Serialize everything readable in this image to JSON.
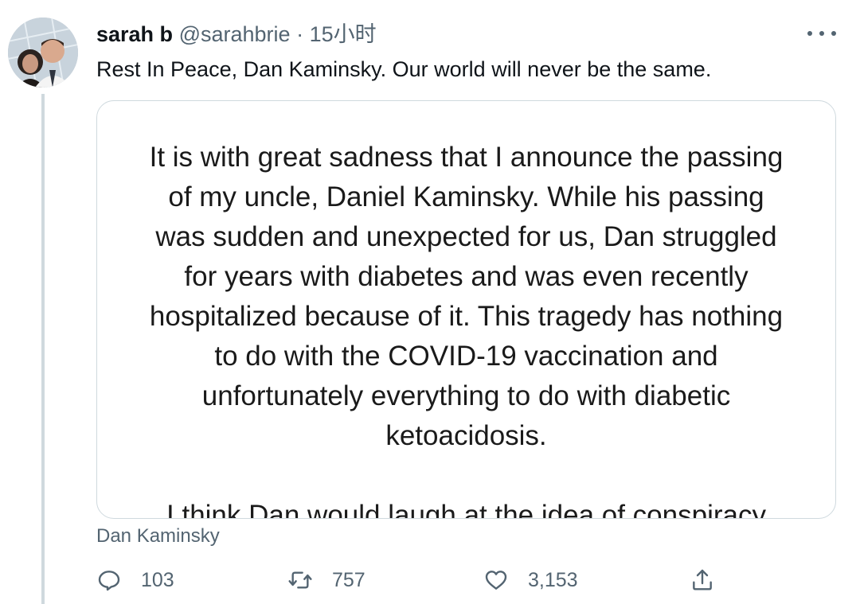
{
  "tweet": {
    "author_name": "sarah b",
    "handle": "@sarahbrie",
    "separator": "·",
    "time": "15小时",
    "text": "Rest In Peace, Dan Kaminsky. Our world will never be the same.",
    "media": {
      "paragraph_1": "It is with great sadness that I announce the passing of my uncle, Daniel Kaminsky. While his passing was sudden and unexpected for us, Dan struggled for years with diabetes and was even recently hospitalized because of it. This tragedy has nothing to do with the COVID-19 vaccination and unfortunately everything to do with diabetic ketoacidosis.",
      "paragraph_2_partial": "I think Dan would laugh at the idea of conspiracy"
    },
    "media_caption": "Dan Kaminsky",
    "stats": {
      "replies": "103",
      "retweets": "757",
      "likes": "3,153"
    }
  },
  "icons": {
    "more": "more-icon",
    "reply": "reply-icon",
    "retweet": "retweet-icon",
    "like": "heart-icon",
    "share": "share-icon"
  },
  "colors": {
    "text_primary": "#0f1419",
    "text_secondary": "#536471",
    "border": "#cfd9de"
  }
}
